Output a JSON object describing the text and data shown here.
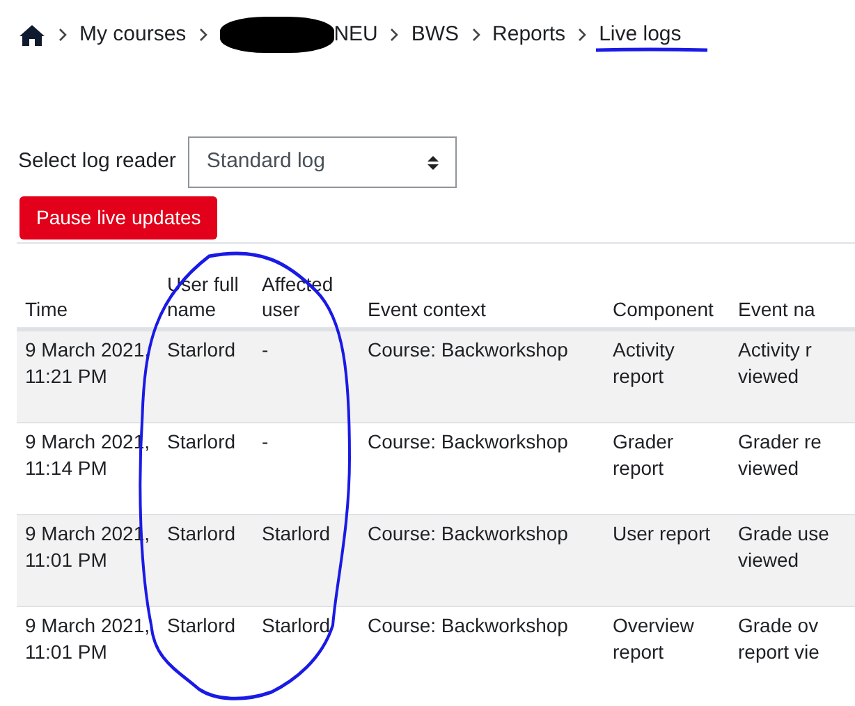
{
  "breadcrumb": [
    {
      "label": "My courses"
    },
    {
      "label": "NEU",
      "redacted": true
    },
    {
      "label": "BWS"
    },
    {
      "label": "Reports"
    },
    {
      "label": "Live logs"
    }
  ],
  "log_reader": {
    "label": "Select log reader",
    "value": "Standard log"
  },
  "pause_button": "Pause live updates",
  "table": {
    "columns": [
      "Time",
      "User full name",
      "Affected user",
      "Event context",
      "Component",
      "Event na"
    ],
    "rows": [
      {
        "cells": [
          "9 March 2021, 11:21 PM",
          "Starlord",
          "-",
          "Course: Backworkshop",
          "Activity report",
          "Activity r\nviewed"
        ]
      },
      {
        "cells": [
          "9 March 2021, 11:14 PM",
          "Starlord",
          "-",
          "Course: Backworkshop",
          "Grader report",
          "Grader re\nviewed"
        ]
      },
      {
        "cells": [
          "9 March 2021, 11:01 PM",
          "Starlord",
          "Starlord",
          "Course: Backworkshop",
          "User report",
          "Grade use\nviewed"
        ]
      },
      {
        "cells": [
          "9 March 2021, 11:01 PM",
          "Starlord",
          "Starlord",
          "Course: Backworkshop",
          "Overview report",
          "Grade ov\nreport vie"
        ]
      }
    ]
  }
}
